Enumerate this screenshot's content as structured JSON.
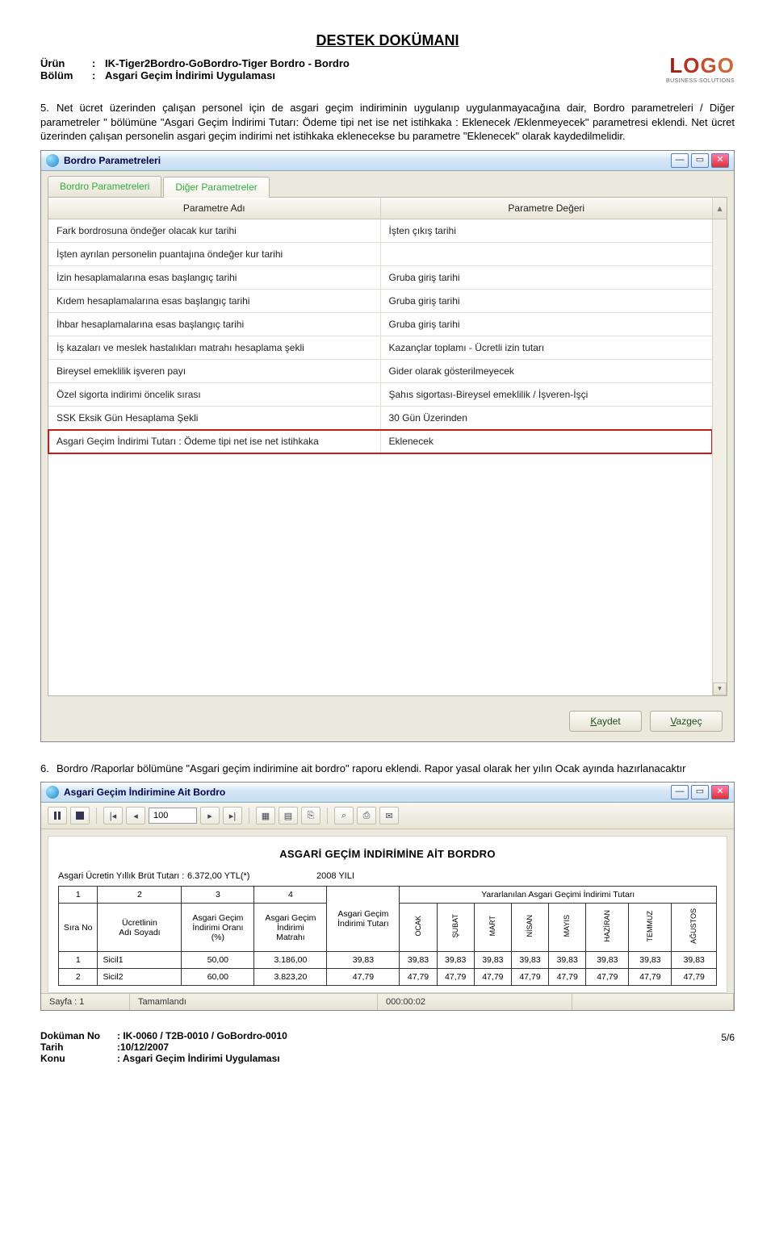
{
  "doc": {
    "title": "DESTEK DOKÜMANI",
    "product_label": "Ürün",
    "product_value": "IK-Tiger2Bordro-GoBordro-Tiger Bordro - Bordro",
    "section_label": "Bölüm",
    "section_value": "Asgari Geçim İndirimi Uygulaması",
    "logo_sub": "BUSINESS SOLUTIONS"
  },
  "para5": {
    "num": "5.",
    "text": "Net ücret üzerinden çalışan personel için de asgari geçim indiriminin uygulanıp uygulanmayacağına dair, Bordro parametreleri / Diğer parametreler \" bölümüne \"Asgari Geçim İndirimi Tutarı: Ödeme tipi net ise net istihkaka : Eklenecek /Eklenmeyecek\" parametresi eklendi. Net ücret üzerinden çalışan personelin asgari geçim indirimi net istihkaka eklenecekse bu parametre \"Eklenecek\" olarak kaydedilmelidir."
  },
  "win1": {
    "title": "Bordro Parametreleri",
    "tabs": [
      "Bordro Parametreleri",
      "Diğer Parametreler"
    ],
    "headers": {
      "param": "Parametre Adı",
      "value": "Parametre Değeri"
    },
    "rows": [
      {
        "p": "Fark bordrosuna öndeğer olacak kur tarihi",
        "v": "İşten çıkış tarihi"
      },
      {
        "p": "İşten ayrılan personelin puantajına öndeğer kur tarihi",
        "v": ""
      },
      {
        "p": "İzin hesaplamalarına esas başlangıç tarihi",
        "v": "Gruba giriş tarihi"
      },
      {
        "p": "Kıdem hesaplamalarına esas başlangıç tarihi",
        "v": "Gruba giriş tarihi"
      },
      {
        "p": "İhbar hesaplamalarına esas başlangıç tarihi",
        "v": "Gruba giriş tarihi"
      },
      {
        "p": "İş kazaları ve meslek hastalıkları matrahı hesaplama şekli",
        "v": "Kazançlar toplamı - Ücretli izin tutarı"
      },
      {
        "p": "Bireysel emeklilik işveren payı",
        "v": "Gider olarak gösterilmeyecek"
      },
      {
        "p": "Özel sigorta indirimi öncelik sırası",
        "v": "Şahıs sigortası-Bireysel emeklilik / İşveren-İşçi"
      },
      {
        "p": "SSK Eksik Gün Hesaplama Şekli",
        "v": "30 Gün Üzerinden"
      },
      {
        "p": "Asgari Geçim İndirimi Tutarı : Ödeme tipi net ise net istihkaka",
        "v": "Eklenecek",
        "hl": true
      }
    ],
    "buttons": {
      "save": "Kaydet",
      "cancel": "Vazgeç"
    }
  },
  "para6": {
    "num": "6.",
    "text": "Bordro /Raporlar bölümüne \"Asgari geçim indirimine ait bordro\" raporu eklendi. Rapor yasal olarak her yılın Ocak ayında hazırlanacaktır"
  },
  "win2": {
    "title": "Asgari Geçim İndirimine Ait Bordro",
    "page_input": "100",
    "report_title": "ASGARİ GEÇİM İNDİRİMİNE AİT BORDRO",
    "top": {
      "label": "Asgari Ücretin Yıllık Brüt Tutarı :",
      "value": "6.372,00 YTL(*)",
      "year": "2008 YILI"
    },
    "cols": {
      "sira": "Sıra No",
      "ad": "Ücretlinin\nAdı Soyadı",
      "oran": "Asgari Geçim\nİndirimi Oranı\n(%)",
      "matrah": "Asgari Geçim\nİndirimi\nMatrahı",
      "tutar": "Asgari Geçim\nİndirimi Tutarı",
      "yar": "Yararlanılan Asgari Geçimi İndirimi Tutarı",
      "months": [
        "OCAK",
        "ŞUBAT",
        "MART",
        "NİSAN",
        "MAYIS",
        "HAZİRAN",
        "TEMMUZ",
        "AĞUSTOS"
      ],
      "col_nums": [
        "1",
        "2",
        "3",
        "4"
      ]
    },
    "rows": [
      {
        "no": "1",
        "ad": "Sicil1",
        "oran": "50,00",
        "matrah": "3.186,00",
        "tutar": "39,83",
        "m": [
          "39,83",
          "39,83",
          "39,83",
          "39,83",
          "39,83",
          "39,83",
          "39,83",
          "39,83"
        ]
      },
      {
        "no": "2",
        "ad": "Sicil2",
        "oran": "60,00",
        "matrah": "3.823,20",
        "tutar": "47,79",
        "m": [
          "47,79",
          "47,79",
          "47,79",
          "47,79",
          "47,79",
          "47,79",
          "47,79",
          "47,79"
        ]
      }
    ],
    "status": {
      "page": "Sayfa : 1",
      "state": "Tamamlandı",
      "time": "000:00:02"
    }
  },
  "footer": {
    "docno_l": "Doküman No",
    "docno_v": ": IK-0060 / T2B-0010 / GoBordro-0010",
    "date_l": "Tarih",
    "date_v": ":10/12/2007",
    "subj_l": "Konu",
    "subj_v": ": Asgari Geçim İndirimi Uygulaması",
    "page": "5/6"
  }
}
